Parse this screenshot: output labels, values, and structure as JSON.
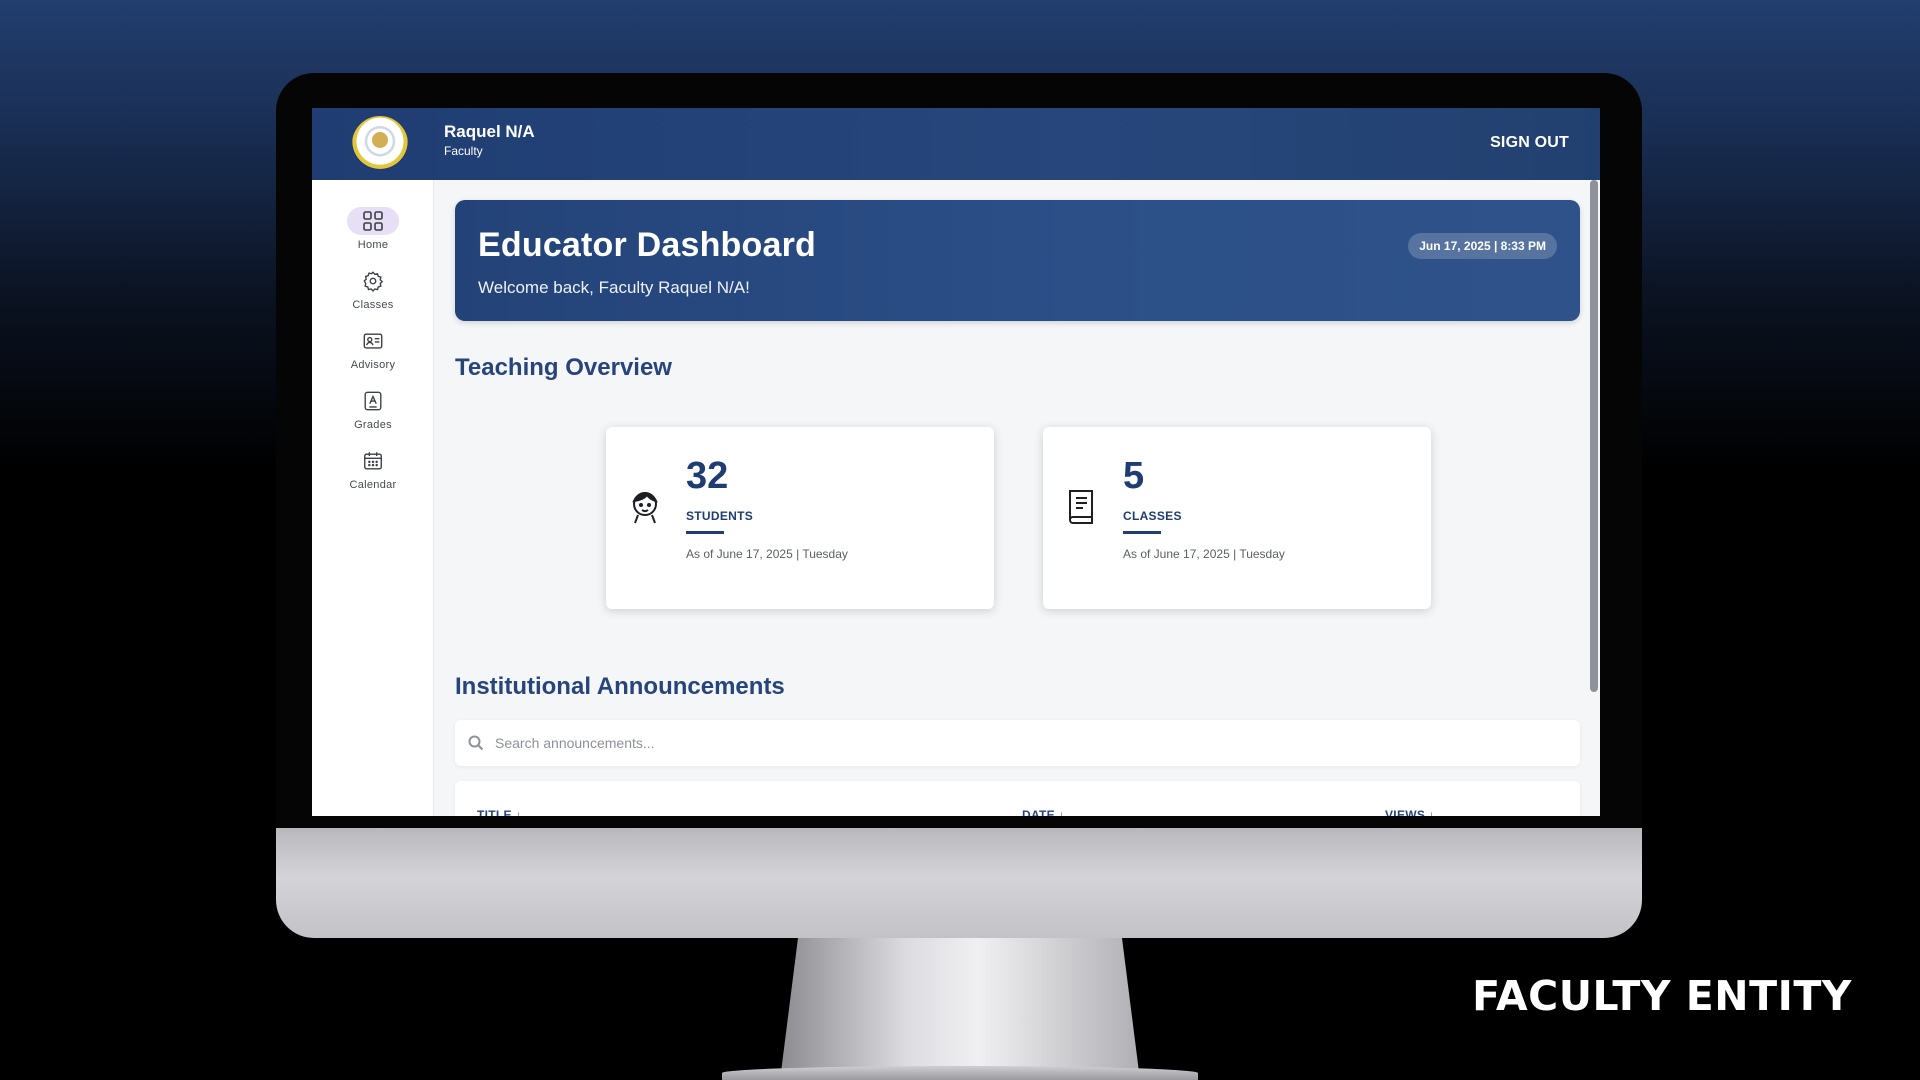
{
  "caption": "FACULTY ENTITY",
  "header": {
    "user_name": "Raquel N/A",
    "user_role": "Faculty",
    "sign_out": "SIGN OUT"
  },
  "sidebar": {
    "items": [
      {
        "label": "Home",
        "icon": "grid-icon",
        "active": true
      },
      {
        "label": "Classes",
        "icon": "gear-icon",
        "active": false
      },
      {
        "label": "Advisory",
        "icon": "id-card-icon",
        "active": false
      },
      {
        "label": "Grades",
        "icon": "grade-badge-icon",
        "active": false
      },
      {
        "label": "Calendar",
        "icon": "calendar-icon",
        "active": false
      }
    ]
  },
  "hero": {
    "title": "Educator Dashboard",
    "subtitle": "Welcome back, Faculty Raquel N/A!",
    "datetime": "Jun 17, 2025 | 8:33 PM"
  },
  "overview": {
    "title": "Teaching Overview",
    "cards": [
      {
        "value": "32",
        "label": "STUDENTS",
        "meta": "As of June 17, 2025 | Tuesday",
        "icon": "student-icon"
      },
      {
        "value": "5",
        "label": "CLASSES",
        "meta": "As of June 17, 2025 | Tuesday",
        "icon": "book-icon"
      }
    ]
  },
  "announcements": {
    "title": "Institutional Announcements",
    "search_placeholder": "Search announcements...",
    "columns": [
      "TITLE ↓",
      "DATE ↓",
      "VIEWS ↓"
    ]
  },
  "colors": {
    "primary": "#1f3d72",
    "accent_active": "#e6dff6",
    "background": "#f5f6f8"
  }
}
